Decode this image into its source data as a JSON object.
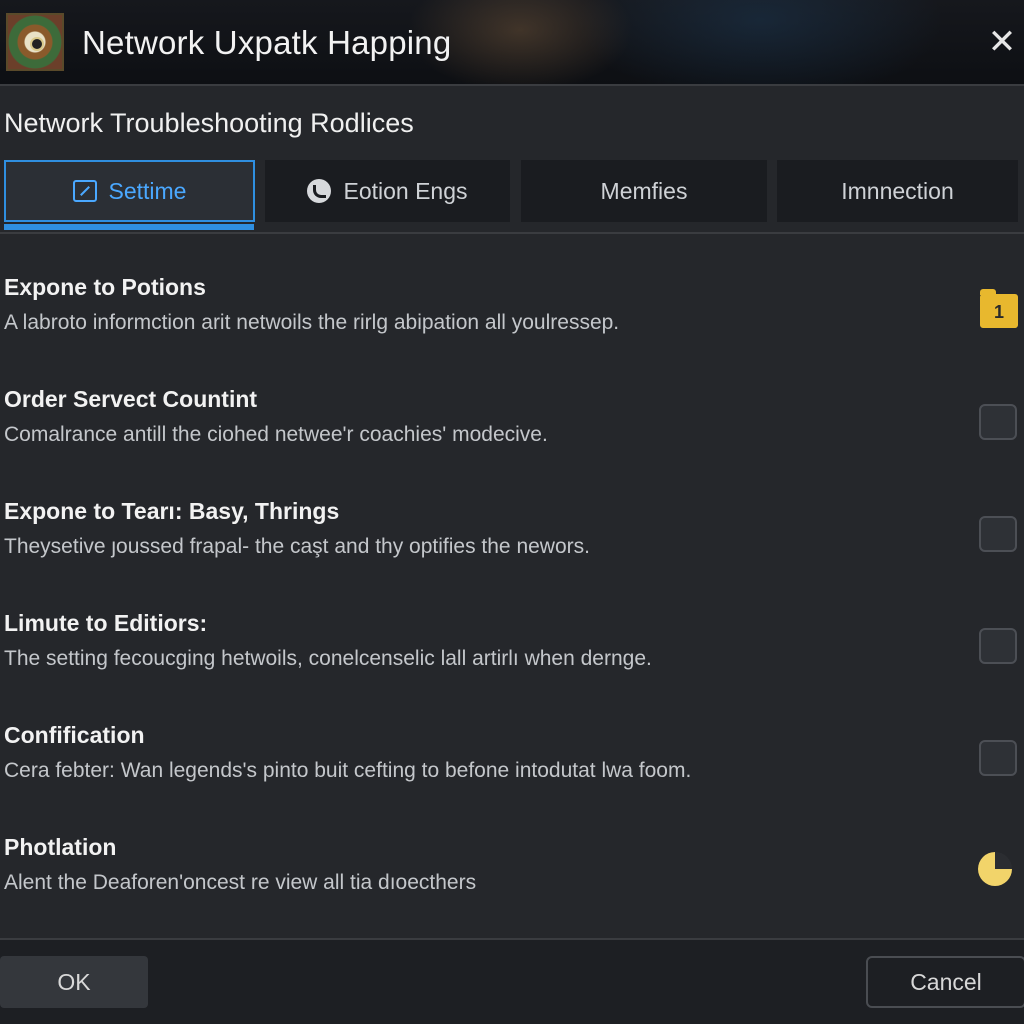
{
  "window": {
    "title": "Network Uxpatk Happing",
    "close_glyph": "✕"
  },
  "section": {
    "title": "Network Troubleshooting Rodlices"
  },
  "tabs": [
    {
      "label": "Settime",
      "icon": "edit-icon",
      "active": true
    },
    {
      "label": "Eotion Engs",
      "icon": "clock-icon",
      "active": false
    },
    {
      "label": "Memfies",
      "active": false
    },
    {
      "label": "Imnnection",
      "active": false
    }
  ],
  "settings": [
    {
      "title": "Expone to Potions",
      "description": "A labroto informction arit netwoils the rirlg abipation all youlressep.",
      "control": "folder-badge",
      "badge_text": "1"
    },
    {
      "title": "Order Servect Countint",
      "description": "Comalrance antill the ciohed netwee'r coachies' modecive.",
      "control": "checkbox",
      "checked": false
    },
    {
      "title": "Expone to Tearı: Basy, Thrings",
      "description": "Theysetive ȷoussed frapal- the caşt and thy optifies the newors.",
      "control": "checkbox",
      "checked": false
    },
    {
      "title": "Limute to Editiors:",
      "description": "The setting fecoucging hetwoils, conelcenselic lall artirlı when dernge.",
      "control": "checkbox",
      "checked": false
    },
    {
      "title": "Confification",
      "description": "Cera febter: Wan legends's pinto buit cefting to befone intodutat lwa foom.",
      "control": "checkbox",
      "checked": false
    },
    {
      "title": "Photlation",
      "description": "Alent the Deaforen'oncest re view all tia dıoecthers",
      "control": "pie-toggle"
    }
  ],
  "footer": {
    "ok_label": "OK",
    "cancel_label": "Cancel"
  },
  "colors": {
    "accent": "#2f8fe0",
    "badge": "#e8b82e",
    "toggle": "#f2d46a"
  }
}
